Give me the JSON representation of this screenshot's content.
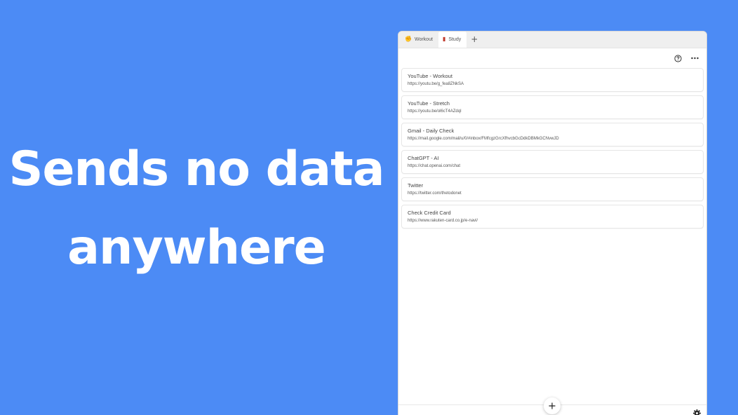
{
  "headline": {
    "line1": "Sends no data",
    "line2": "anywhere"
  },
  "tabs": [
    {
      "icon": "flexed-biceps-icon",
      "label": "Workout",
      "active": false
    },
    {
      "icon": "book-icon",
      "label": "Study",
      "active": true
    }
  ],
  "tab_add_label": "+",
  "toolbar": {
    "help_icon": "help-circle-icon",
    "more_icon": "more-horizontal-icon"
  },
  "items": [
    {
      "title": "YouTube - Workout",
      "url": "https://youtu.be/g_fea8ZNkSA"
    },
    {
      "title": "YouTube - Stretch",
      "url": "https://youtu.be/ol6cT4AZdqI"
    },
    {
      "title": "Gmail - Daily Check",
      "url": "https://mail.google.com/mail/u/0/#inbox/FMfcgzGrcXfhvcbGcDdkDBMkGCNvwJD"
    },
    {
      "title": "ChatGPT - AI",
      "url": "https://chat.openai.com/chat"
    },
    {
      "title": "Twitter",
      "url": "https://twitter.com/thetodonet"
    },
    {
      "title": "Check Credit Card",
      "url": "https://www.rakuten-card.co.jp/e-navi/"
    }
  ],
  "colors": {
    "background": "#4c8bf5",
    "headline": "#ffffff"
  }
}
